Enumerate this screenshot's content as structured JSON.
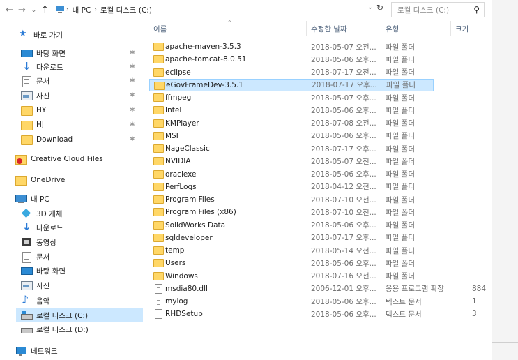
{
  "toolbar": {
    "back_icon": "←",
    "forward_icon": "→",
    "recent_icon": "⌄",
    "up_icon": "↑",
    "breadcrumb": [
      "내 PC",
      "로컬 디스크 (C:)"
    ],
    "breadcrumb_sep": "›",
    "dropdown_icon": "⌄",
    "refresh_icon": "↻",
    "search_placeholder": "로컬 디스크 (C:)",
    "search_icon": "⚲"
  },
  "nav": {
    "pin_icon": "✱",
    "items": [
      {
        "label": "바로 가기",
        "icon": "star-icon",
        "pinned": false
      },
      {
        "label": "바탕 화면",
        "icon": "desktop-icon",
        "pinned": true
      },
      {
        "label": "다운로드",
        "icon": "download-icon",
        "pinned": true
      },
      {
        "label": "문서",
        "icon": "document-icon",
        "pinned": true
      },
      {
        "label": "사진",
        "icon": "picture-icon",
        "pinned": true
      },
      {
        "label": "HY",
        "icon": "folder-icon",
        "pinned": true
      },
      {
        "label": "HJ",
        "icon": "folder-icon",
        "pinned": true
      },
      {
        "label": "Download",
        "icon": "folder-icon",
        "pinned": true
      },
      {
        "label": "Creative Cloud Files",
        "icon": "creative-cloud-icon",
        "pinned": false
      },
      {
        "label": "OneDrive",
        "icon": "onedrive-icon",
        "pinned": false
      },
      {
        "label": "내 PC",
        "icon": "pc-icon",
        "pinned": false
      },
      {
        "label": "3D 개체",
        "icon": "3d-objects-icon",
        "pinned": false
      },
      {
        "label": "다운로드",
        "icon": "download-icon",
        "pinned": false
      },
      {
        "label": "동영상",
        "icon": "video-icon",
        "pinned": false
      },
      {
        "label": "문서",
        "icon": "document-icon",
        "pinned": false
      },
      {
        "label": "바탕 화면",
        "icon": "desktop-icon",
        "pinned": false
      },
      {
        "label": "사진",
        "icon": "picture-icon",
        "pinned": false
      },
      {
        "label": "음악",
        "icon": "music-icon",
        "pinned": false
      },
      {
        "label": "로컬 디스크 (C:)",
        "icon": "drive-c-icon",
        "pinned": false,
        "selected": true
      },
      {
        "label": "로컬 디스크 (D:)",
        "icon": "drive-d-icon",
        "pinned": false
      },
      {
        "label": "네트워크",
        "icon": "network-icon",
        "pinned": false
      }
    ]
  },
  "list": {
    "sort_arrow": "^",
    "columns": [
      "이름",
      "수정한 날짜",
      "유형",
      "크기"
    ],
    "rows": [
      {
        "name": "apache-maven-3.5.3",
        "date": "2018-05-07 오전...",
        "type": "파일 폴더",
        "size": "",
        "kind": "folder"
      },
      {
        "name": "apache-tomcat-8.0.51",
        "date": "2018-05-06 오후...",
        "type": "파일 폴더",
        "size": "",
        "kind": "folder"
      },
      {
        "name": "eclipse",
        "date": "2018-07-17 오전...",
        "type": "파일 폴더",
        "size": "",
        "kind": "folder"
      },
      {
        "name": "eGovFrameDev-3.5.1",
        "date": "2018-07-17 오후...",
        "type": "파일 폴더",
        "size": "",
        "kind": "folder",
        "selected": true
      },
      {
        "name": "ffmpeg",
        "date": "2018-05-07 오후...",
        "type": "파일 폴더",
        "size": "",
        "kind": "folder"
      },
      {
        "name": "Intel",
        "date": "2018-05-06 오후...",
        "type": "파일 폴더",
        "size": "",
        "kind": "folder"
      },
      {
        "name": "KMPlayer",
        "date": "2018-07-08 오전...",
        "type": "파일 폴더",
        "size": "",
        "kind": "folder"
      },
      {
        "name": "MSI",
        "date": "2018-05-06 오후...",
        "type": "파일 폴더",
        "size": "",
        "kind": "folder"
      },
      {
        "name": "NageClassic",
        "date": "2018-07-17 오후...",
        "type": "파일 폴더",
        "size": "",
        "kind": "folder"
      },
      {
        "name": "NVIDIA",
        "date": "2018-05-07 오전...",
        "type": "파일 폴더",
        "size": "",
        "kind": "folder"
      },
      {
        "name": "oraclexe",
        "date": "2018-05-06 오후...",
        "type": "파일 폴더",
        "size": "",
        "kind": "folder"
      },
      {
        "name": "PerfLogs",
        "date": "2018-04-12 오전...",
        "type": "파일 폴더",
        "size": "",
        "kind": "folder"
      },
      {
        "name": "Program Files",
        "date": "2018-07-10 오전...",
        "type": "파일 폴더",
        "size": "",
        "kind": "folder"
      },
      {
        "name": "Program Files (x86)",
        "date": "2018-07-10 오전...",
        "type": "파일 폴더",
        "size": "",
        "kind": "folder"
      },
      {
        "name": "SolidWorks Data",
        "date": "2018-05-06 오후...",
        "type": "파일 폴더",
        "size": "",
        "kind": "folder"
      },
      {
        "name": "sqldeveloper",
        "date": "2018-07-17 오후...",
        "type": "파일 폴더",
        "size": "",
        "kind": "folder"
      },
      {
        "name": "temp",
        "date": "2018-05-14 오전...",
        "type": "파일 폴더",
        "size": "",
        "kind": "folder"
      },
      {
        "name": "Users",
        "date": "2018-05-06 오후...",
        "type": "파일 폴더",
        "size": "",
        "kind": "folder"
      },
      {
        "name": "Windows",
        "date": "2018-07-16 오전...",
        "type": "파일 폴더",
        "size": "",
        "kind": "folder"
      },
      {
        "name": "msdia80.dll",
        "date": "2006-12-01 오후...",
        "type": "응용 프로그램 확장",
        "size": "884",
        "kind": "file"
      },
      {
        "name": "mylog",
        "date": "2018-05-06 오후...",
        "type": "텍스트 문서",
        "size": "1",
        "kind": "file"
      },
      {
        "name": "RHDSetup",
        "date": "2018-05-06 오후...",
        "type": "텍스트 문서",
        "size": "3",
        "kind": "file"
      }
    ]
  }
}
